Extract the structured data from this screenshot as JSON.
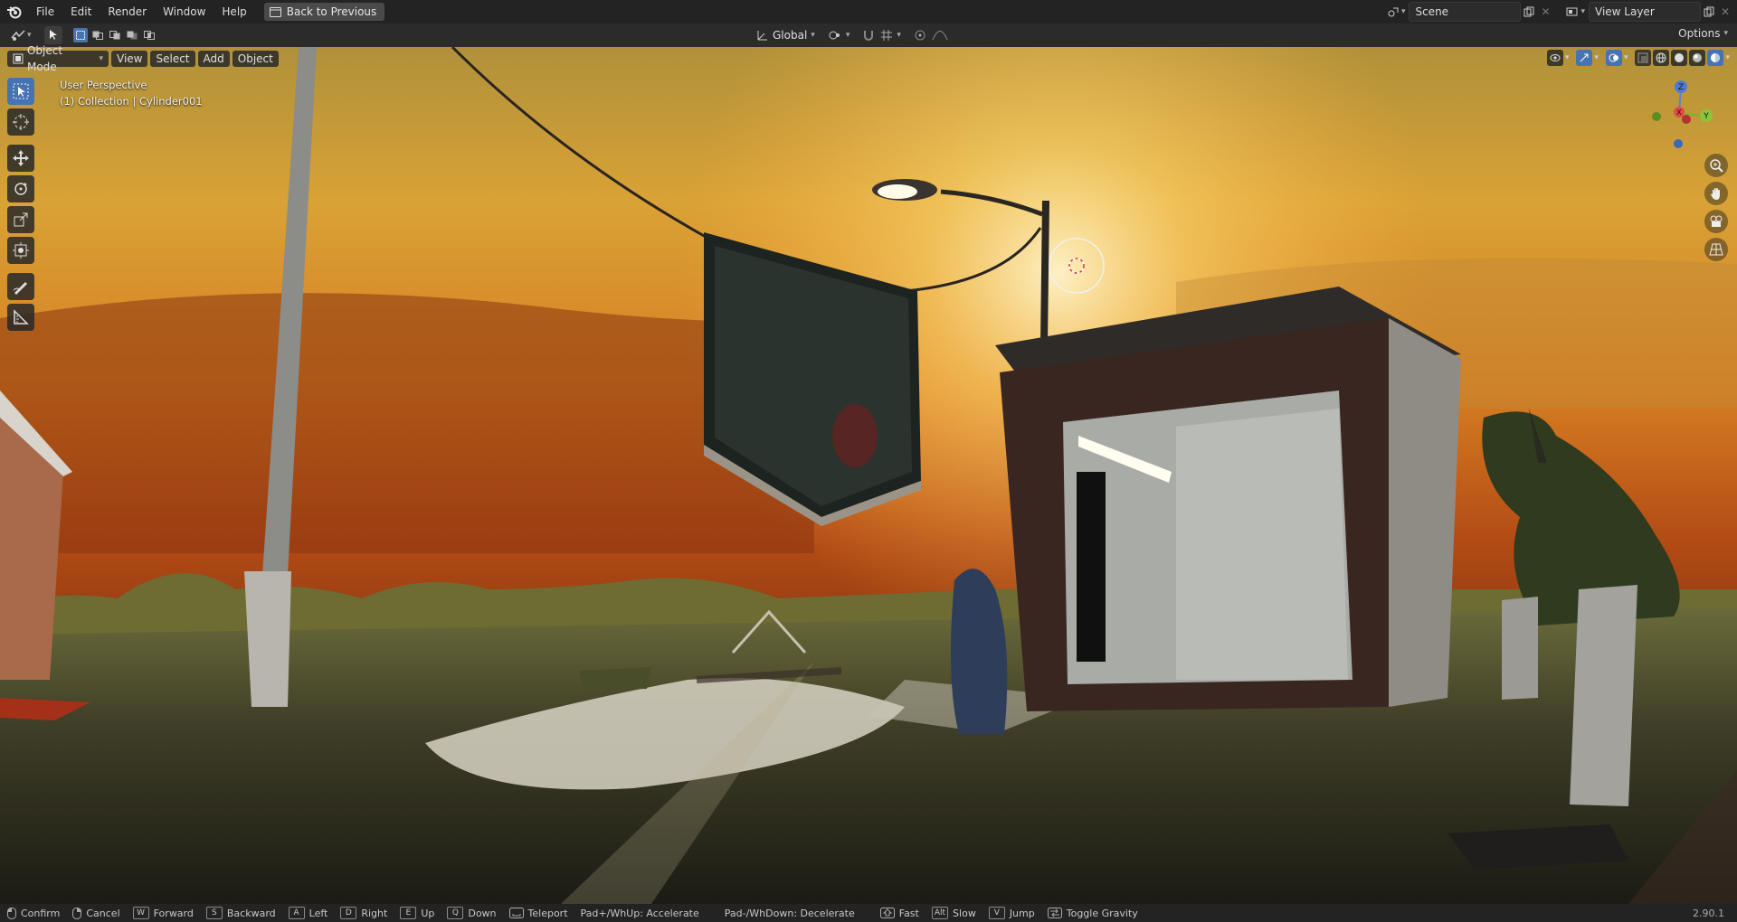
{
  "menu": {
    "items": [
      "File",
      "Edit",
      "Render",
      "Window",
      "Help"
    ],
    "back_button": "Back to Previous"
  },
  "top_right": {
    "scene": "Scene",
    "view_layer": "View Layer"
  },
  "toolbar": {
    "transform_orientation": "Global",
    "options": "Options"
  },
  "viewport_header": {
    "mode": "Object Mode",
    "view": "View",
    "select": "Select",
    "add": "Add",
    "object": "Object"
  },
  "overlay": {
    "perspective": "User Perspective",
    "collection": "(1) Collection | Cylinder001"
  },
  "status_bar": {
    "items": [
      {
        "key": "",
        "label": "Confirm"
      },
      {
        "key": "",
        "label": "Cancel"
      },
      {
        "key": "W",
        "label": "Forward"
      },
      {
        "key": "S",
        "label": "Backward"
      },
      {
        "key": "A",
        "label": "Left"
      },
      {
        "key": "D",
        "label": "Right"
      },
      {
        "key": "E",
        "label": "Up"
      },
      {
        "key": "Q",
        "label": "Down"
      },
      {
        "key": "",
        "label": "Teleport"
      },
      {
        "key": "",
        "label": "Pad+/WhUp: Accelerate"
      },
      {
        "key": "",
        "label": "Pad-/WhDown: Decelerate"
      },
      {
        "key": "",
        "label": "Fast"
      },
      {
        "key": "Alt",
        "label": "Slow"
      },
      {
        "key": "V",
        "label": "Jump"
      },
      {
        "key": "",
        "label": "Toggle Gravity"
      }
    ],
    "version": "2.90.1"
  },
  "gizmo": {
    "z": "Z",
    "y": "Y",
    "x": "X"
  },
  "colors": {
    "accent": "#4772b3",
    "sky_top": "#e0a73a",
    "sky_bottom": "#c55a14"
  }
}
